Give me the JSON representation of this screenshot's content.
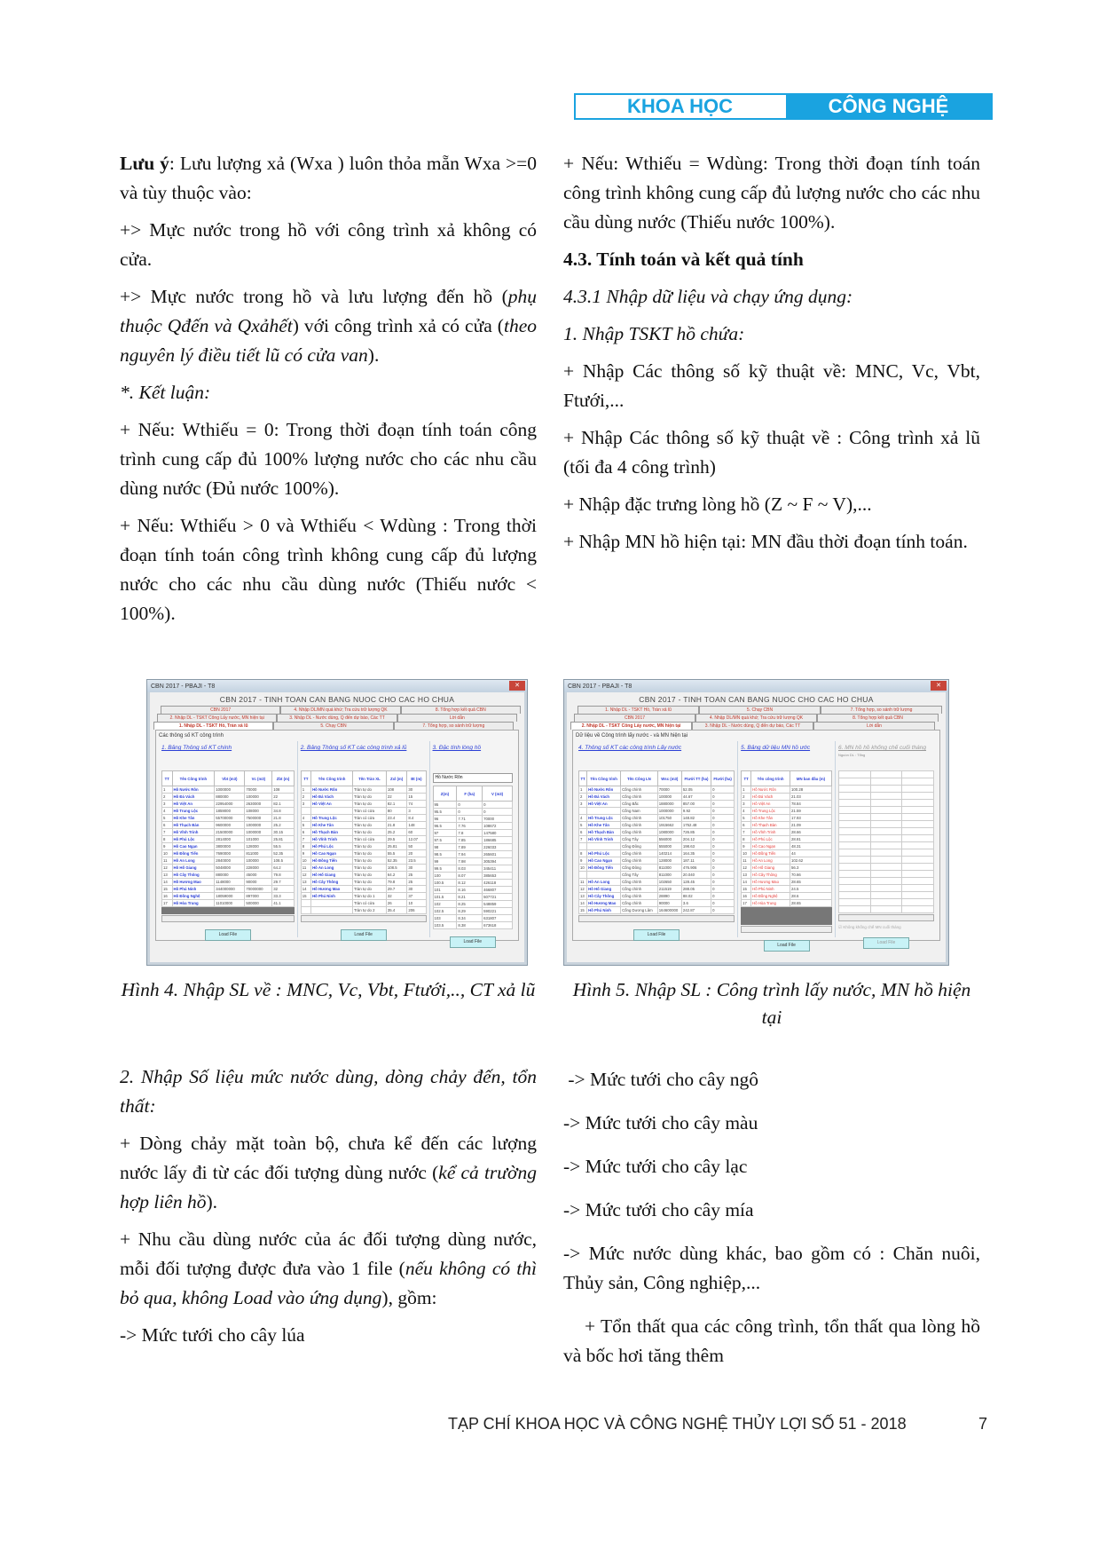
{
  "header": {
    "left": "KHOA HỌC",
    "right": "CÔNG NGHỆ"
  },
  "left_column": {
    "p1_bold": "Lưu ý",
    "p1_rest": ":  Lưu lượng xả (Wxa ) luôn thỏa mẵn Wxa >=0 và tùy thuộc vào:",
    "p2": "+>  Mực nước trong hồ với công trình xả không có cửa.",
    "p3_a": "+>  Mực nước trong hồ và lưu lượng đến hồ (",
    "p3_i1": "phụ thuộc Qđến và Qxảhết",
    "p3_b": ")  với công trình xả có cửa  (",
    "p3_i2": "theo nguyên lý điều tiết lũ có          cửa van",
    "p3_c": ").",
    "p4": "*. Kết luận:",
    "p5": "+  Nếu: Wthiếu = 0: Trong thời đoạn tính toán công trình cung cấp đủ 100% lượng nước cho các nhu cầu dùng nước (Đủ nước 100%).",
    "p6": "+  Nếu: Wthiếu > 0 và Wthiếu <  Wdùng  : Trong thời đoạn tính toán công trình không cung cấp đủ lượng nước cho các nhu cầu dùng nước (Thiếu nước < 100%)."
  },
  "right_column": {
    "p1": "+  Nếu: Wthiếu = Wdùng: Trong thời đoạn tính toán công trình không cung cấp đủ lượng nước cho các nhu cầu dùng nước (Thiếu nước 100%).",
    "h43": "4.3. Tính toán và  kết quả tính",
    "h431": "4.3.1 Nhập dữ liệu và chạy ứng dụng:",
    "h1": "1.  Nhập  TSKT hồ chứa:",
    "b1": "+ Nhập Các thông số kỹ thuật về: MNC, Vc, Vbt, Ftưới,...",
    "b2": "+ Nhập Các thông số kỹ thuật về : Công trình xả lũ (tối đa 4 công trình)",
    "b3": "+ Nhập đặc trưng lòng hồ (Z ~ F ~ V),...",
    "b4": "+ Nhập MN hồ hiện tại: MN đầu thời đoạn tính toán."
  },
  "figure4": {
    "window_title": "CBN 2017 - PBAJI - T8",
    "app_title": "CBN 2017 -  TINH TOAN CAN BANG NUOC CHO CAC HO CHUA",
    "tab_rows": [
      [
        "CBN 2017",
        "4. Nhập DL/MN quá khứ; Tra cứu trữ lượng QK",
        "8. Tổng hợp kết quả CBN"
      ],
      [
        "2. Nhập DL - TSKT Công Lấy nước, MN hiện tại",
        "3. Nhập DL - Nước dùng, Q đến dự báo, Các TT",
        "Lời dẫn"
      ],
      [
        "1. Nhập DL - TSKT Hồ, Tràn xả lũ",
        "5. Chạy CBN",
        "7. Tổng hợp, so sánh trữ lượng"
      ]
    ],
    "group_label": "Các thông số KT công trình",
    "panel1": {
      "title": "1. Bảng Thông số KT  chính",
      "headers": [
        "TT",
        "Tên Công trình",
        "Vbt (m3)",
        "Vc (m3)",
        "Zbt (m)"
      ],
      "rows": [
        [
          "1",
          "Hồ Nước Rôn",
          "1000000",
          "70000",
          "108"
        ],
        [
          "2",
          "Hồ Đá Vách",
          "880000",
          "100000",
          "22"
        ],
        [
          "3",
          "Hồ Việt An",
          "22954000",
          "2630000",
          "82.1"
        ],
        [
          "4",
          "Hồ Trung Lộc",
          "1859000",
          "108000",
          "34.8"
        ],
        [
          "5",
          "Hồ Khe Tân",
          "55700000",
          "7500000",
          "21.8"
        ],
        [
          "6",
          "Hồ Thạch Bàn",
          "9600000",
          "1000000",
          "25.2"
        ],
        [
          "7",
          "Hồ Vĩnh Trinh",
          "21500000",
          "1000000",
          "30.15"
        ],
        [
          "8",
          "Hồ Phú Lộc",
          "2814000",
          "101000",
          "25.81"
        ],
        [
          "9",
          "Hồ Cao Ngạn",
          "3800000",
          "128000",
          "55.5"
        ],
        [
          "10",
          "Hồ Đồng Tiến",
          "7690000",
          "811000",
          "52.35"
        ],
        [
          "11",
          "Hồ An Long",
          "2840000",
          "100000",
          "108.5"
        ],
        [
          "12",
          "Hồ Hố Giang",
          "5048000",
          "228000",
          "64.2"
        ],
        [
          "13",
          "Hồ Cây Thông",
          "880000",
          "45000",
          "79.8"
        ],
        [
          "14",
          "Hồ Hương Mao",
          "1148000",
          "90000",
          "29.7"
        ],
        [
          "15",
          "Hồ Phú Ninh",
          "344000000",
          "70000000",
          "32"
        ],
        [
          "16",
          "Hồ Đồng Nghệ",
          "18059000",
          "897000",
          "33.3"
        ],
        [
          "17",
          "Hồ Hòa Trung",
          "11010000",
          "500000",
          "41.1"
        ]
      ],
      "button": "Load File"
    },
    "panel2": {
      "title": "2. Bảng Thông số KT các công trình xả lũ",
      "headers": [
        "TT",
        "Tên Công trình",
        "Tên Tràn XL",
        "Zxl (m)",
        "Bt (m)"
      ],
      "rows": [
        [
          "1",
          "Hồ Nước Rôn",
          "Tràn tự do",
          "108",
          "30"
        ],
        [
          "2",
          "Hồ Đá Vách",
          "Tràn tự do",
          "22",
          "15"
        ],
        [
          "3",
          "Hồ Việt An",
          "Tràn tự do",
          "82.1",
          "74"
        ],
        [
          "",
          "",
          "Tràn có cửa",
          "80",
          "3"
        ],
        [
          "4",
          "Hồ Trung Lộc",
          "Tràn có cửa",
          "23.4",
          "8.4"
        ],
        [
          "5",
          "Hồ Khe Tân",
          "Tràn tự do",
          "21.8",
          "148"
        ],
        [
          "6",
          "Hồ Thạch Bàn",
          "Tràn tự do",
          "25.2",
          "60"
        ],
        [
          "7",
          "Hồ Vĩnh Trinh",
          "Tràn có cửa",
          "29.5",
          "12.07"
        ],
        [
          "8",
          "Hồ Phú Lộc",
          "Tràn tự do",
          "25.81",
          "50"
        ],
        [
          "9",
          "Hồ Cao Ngạn",
          "Tràn tự do",
          "55.5",
          "20"
        ],
        [
          "10",
          "Hồ Đồng Tiến",
          "Tràn tự do",
          "52.35",
          "23.5"
        ],
        [
          "11",
          "Hồ An Long",
          "Tràn tự do",
          "108.5",
          "30"
        ],
        [
          "12",
          "Hồ Hố Giang",
          "Tràn tự do",
          "64.2",
          "25"
        ],
        [
          "13",
          "Hồ Cây Thông",
          "Tràn tự do",
          "79.8",
          "25"
        ],
        [
          "14",
          "Hồ Hương Mao",
          "Tràn tự do",
          "29.7",
          "30"
        ],
        [
          "15",
          "Hồ Phú Ninh",
          "Tràn tự do 1",
          "32",
          "37"
        ],
        [
          "",
          "",
          "Tràn có cửa",
          "26",
          "10"
        ],
        [
          "",
          "",
          "Tràn tự do 2",
          "35.4",
          "206"
        ]
      ],
      "button": "Load File"
    },
    "panel3": {
      "title": "3. Đặc tính lòng hồ",
      "select": "Hồ Nước Rôn",
      "headers": [
        "Z(m)",
        "F (ha)",
        "V (m3)"
      ],
      "rows": [
        [
          "95",
          "0",
          "0"
        ],
        [
          "95.5",
          "0",
          "0"
        ],
        [
          "96",
          "7.71",
          "70000"
        ],
        [
          "96.5",
          "7.76",
          "108672"
        ],
        [
          "97",
          "7.8",
          "147580"
        ],
        [
          "97.5",
          "7.85",
          "186685"
        ],
        [
          "98",
          "7.89",
          "226033"
        ],
        [
          "98.5",
          "7.94",
          "265601"
        ],
        [
          "99",
          "7.98",
          "305394"
        ],
        [
          "99.5",
          "8.03",
          "345411"
        ],
        [
          "100",
          "8.07",
          "385653"
        ],
        [
          "100.5",
          "8.12",
          "426118"
        ],
        [
          "101",
          "8.16",
          "466807"
        ],
        [
          "101.5",
          "8.21",
          "507721"
        ],
        [
          "102",
          "8.25",
          "548859"
        ],
        [
          "102.5",
          "8.29",
          "590221"
        ],
        [
          "103",
          "8.34",
          "631807"
        ],
        [
          "103.5",
          "8.38",
          "673618"
        ]
      ],
      "button": "Load File"
    }
  },
  "figure5": {
    "window_title": "CBN 2017 - PBAJI - T8",
    "app_title": "CBN 2017 -  TINH TOAN CAN BANG NUOC CHO CAC HO CHUA",
    "tab_rows": [
      [
        "1. Nhập DL - TSKT Hồ, Tràn xả lũ",
        "5. Chạy CBN",
        "7. Tổng hợp, so sánh trữ lượng"
      ],
      [
        "CBN 2017",
        "4. Nhập DL/MN quá khứ; Tra cứu trữ lượng QK",
        "8. Tổng hợp kết quả CBN"
      ],
      [
        "2. Nhập DL - TSKT Công Lấy nước, MN hiện tại",
        "3. Nhập DL - Nước dùng, Q đến dự báo, Các TT",
        "Lời dẫn"
      ]
    ],
    "group_label": "Dữ liệu về Công trình lấy nước - và MN hiện tại",
    "panel1": {
      "title": "4. Thông số KT các công trình Lấy nước",
      "headers": [
        "TT",
        "Tên Công trình",
        "Tên Công LN",
        "Wsc (m3)",
        "Ftưới TT (ha)",
        "Ftưới (ha)"
      ],
      "rows": [
        [
          "1",
          "Hồ Nước Rôn",
          "Cống chính",
          "70000",
          "52.05",
          "0"
        ],
        [
          "2",
          "Hồ Đá Vách",
          "Cống chính",
          "100000",
          "44.67",
          "0"
        ],
        [
          "3",
          "Hồ Việt An",
          "Cống Bắc",
          "1880000",
          "857.00",
          "0"
        ],
        [
          "",
          "",
          "Cống Nam",
          "1000000",
          "9.92",
          "0"
        ],
        [
          "4",
          "Hồ Trung Lộc",
          "Cống chính",
          "101750",
          "148.82",
          "0"
        ],
        [
          "5",
          "Hồ Khe Tân",
          "Cống chính",
          "1915662",
          "1752.48",
          "0"
        ],
        [
          "6",
          "Hồ Thạch Bàn",
          "Cống chính",
          "1080000",
          "726.85",
          "0"
        ],
        [
          "7",
          "Hồ Vĩnh Trinh",
          "Cống Tây",
          "556000",
          "204.12",
          "0"
        ],
        [
          "",
          "",
          "Cống Đông",
          "555000",
          "198.63",
          "0"
        ],
        [
          "8",
          "Hồ Phú Lộc",
          "Cống chính",
          "140214",
          "164.35",
          "0"
        ],
        [
          "9",
          "Hồ Cao Ngạn",
          "Cống chính",
          "128000",
          "187.11",
          "0"
        ],
        [
          "10",
          "Hồ Đồng Tiến",
          "Cống Đông",
          "811000",
          "476.906",
          "0"
        ],
        [
          "",
          "",
          "Cống Tây",
          "811000",
          "20.040",
          "0"
        ],
        [
          "11",
          "Hồ An Long",
          "Cống chính",
          "102650",
          "128.45",
          "0"
        ],
        [
          "12",
          "Hồ Hố Giang",
          "Cống chính",
          "211519",
          "288.05",
          "0"
        ],
        [
          "13",
          "Hồ Cây Thông",
          "Cống chính",
          "28890",
          "88.02",
          "0"
        ],
        [
          "14",
          "Hồ Hương Mao",
          "Cống chính",
          "90000",
          "3.6",
          "0"
        ],
        [
          "15",
          "Hồ Phú Ninh",
          "Cống Dương Lâm",
          "164600000",
          "242.87",
          "0"
        ]
      ],
      "button": "Load File"
    },
    "panel2": {
      "title": "5. Bảng dữ liệu MN hồ ước",
      "headers": [
        "TT",
        "Tên công trình",
        "MN ban đầu (m)"
      ],
      "rows": [
        [
          "1",
          "Hồ Nước Rôn",
          "100.28"
        ],
        [
          "2",
          "Hồ Đá Vách",
          "21.03"
        ],
        [
          "3",
          "Hồ Việt An",
          "78.84"
        ],
        [
          "4",
          "Hồ Trung Lộc",
          "21.59"
        ],
        [
          "5",
          "Hồ Khe Tân",
          "17.93"
        ],
        [
          "6",
          "Hồ Thạch Bàn",
          "21.09"
        ],
        [
          "7",
          "Hồ Vĩnh Trinh",
          "28.66"
        ],
        [
          "8",
          "Hồ Phú Lộc",
          "28.81"
        ],
        [
          "9",
          "Hồ Cao Ngạn",
          "48.31"
        ],
        [
          "10",
          "Hồ Đồng Tiến",
          "44"
        ],
        [
          "11",
          "Hồ An Long",
          "102.62"
        ],
        [
          "12",
          "Hồ Hố Giang",
          "56.3"
        ],
        [
          "13",
          "Hồ Cây Thông",
          "70.66"
        ],
        [
          "14",
          "Hồ Hương Mao",
          "28.65"
        ],
        [
          "15",
          "Hồ Phú Ninh",
          "24.5"
        ],
        [
          "16",
          "Hồ Đồng Nghệ",
          "28.6"
        ],
        [
          "17",
          "Hồ Hòa Trung",
          "28.65"
        ]
      ],
      "button": "Load File"
    },
    "panel3": {
      "title": "6. MN hồ hồ khống chế cuối tháng",
      "note": "Nguồn DL : Tổng",
      "checkbox": "Không khống chế MN cuối tháng",
      "button": "Load File"
    }
  },
  "captions": {
    "fig4": "Hình 4. Nhập SL về : MNC, Vc, Vbt, Ftưới,.., CT xả lũ",
    "fig5": "Hình 5. Nhập SL : Công trình lấy nước, MN hồ hiện tại"
  },
  "left_column_2": {
    "h2": "2. Nhập Số liệu mức nước dùng, dòng chảy đến, tổn thất:",
    "p1_a": "+ Dòng chảy mặt toàn bộ, chưa kể đến các lượng nước lấy đi từ các đối tượng dùng nước (",
    "p1_i": "kể cả trường hợp liên hồ",
    "p1_b": ").",
    "p2_a": "+ Nhu cầu dùng nước của ác đối tượng dùng nước, mỗi đối tượng được đưa vào 1 file (",
    "p2_i": "nếu không có thì bỏ qua, không Load vào ứng dụng",
    "p2_b": "), gồm:",
    "p3": "-> Mức tưới cho cây lúa"
  },
  "right_column_2": {
    "items": [
      " -> Mức tưới cho cây ngô",
      "-> Mức tưới cho cây màu",
      "-> Mức tưới cho cây lạc",
      "-> Mức tưới cho cây mía",
      "-> Mức nước dùng khác, bao gồm có : Chăn nuôi, Thủy sản, Công nghiệp,...",
      "    + Tổn thất qua các công trình, tổn thất qua lòng hồ và bốc hơi tăng thêm"
    ]
  },
  "footer": {
    "journal": "TẠP CHÍ KHOA HỌC VÀ CÔNG NGHỆ THỦY LỢI SỐ 51 - 2018",
    "page": "7"
  },
  "colors": {
    "accent": "#1aa3e0",
    "table_name": "#2b3fd6",
    "table_red": "#e53935"
  }
}
